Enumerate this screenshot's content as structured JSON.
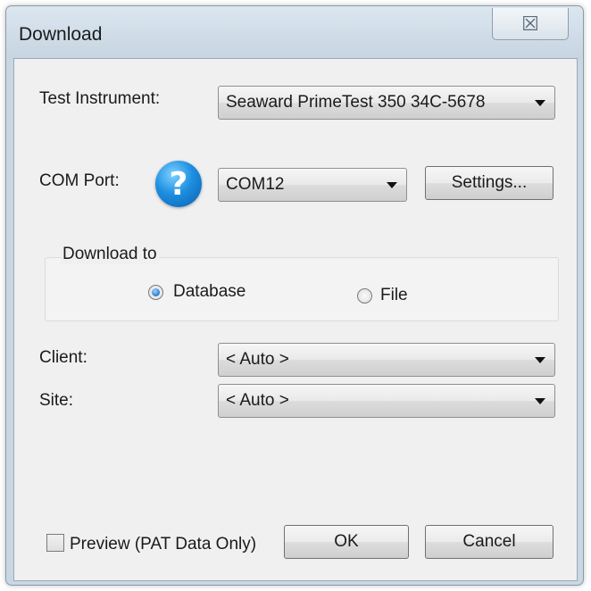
{
  "window": {
    "title": "Download",
    "close_glyph": "☒"
  },
  "instrument": {
    "label": "Test Instrument:",
    "value": "Seaward PrimeTest 350 34C-5678"
  },
  "com_port": {
    "label": "COM Port:",
    "value": "COM12",
    "help_glyph": "?",
    "settings_label": "Settings..."
  },
  "download_to": {
    "title": "Download to",
    "options": [
      {
        "label": "Database",
        "checked": true
      },
      {
        "label": "File",
        "checked": false
      }
    ]
  },
  "client": {
    "label": "Client:",
    "value": "< Auto >"
  },
  "site": {
    "label": "Site:",
    "value": "< Auto >"
  },
  "preview": {
    "label": "Preview (PAT Data Only)",
    "checked": false
  },
  "buttons": {
    "ok_label": "OK",
    "cancel_label": "Cancel"
  },
  "colors": {
    "frame": "#c9d7e3",
    "client_bg": "#f0f0f0",
    "help_icon": "#1d8fe0"
  }
}
